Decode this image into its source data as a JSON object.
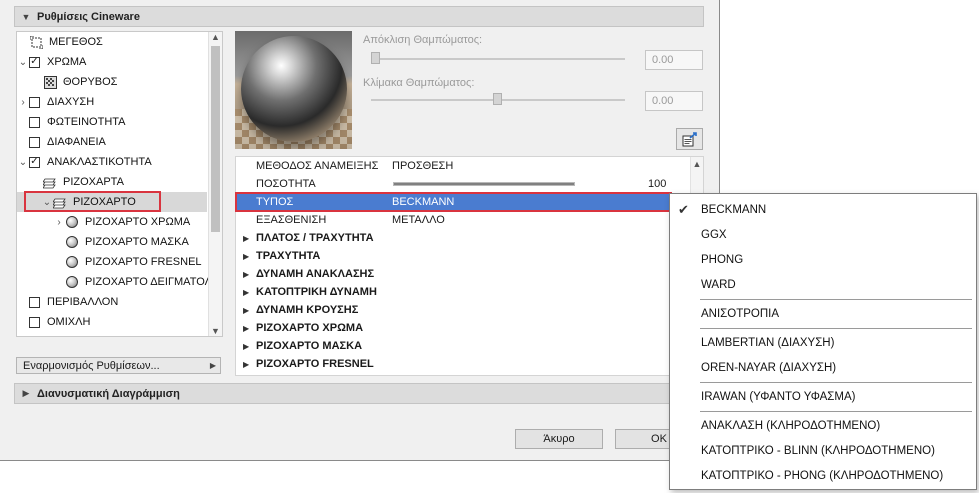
{
  "dialog": {
    "section_settings": "Ρυθμίσεις Cineware",
    "section_vector": "Διανυσματική Διαγράμμιση",
    "preset_label": "Εναρμονισμός Ρυθμίσεων...",
    "cancel_label": "Άκυρο",
    "ok_label": "OK"
  },
  "tree": {
    "items": [
      {
        "label": "ΜΕΓΕΘΟΣ"
      },
      {
        "label": "ΧΡΩΜΑ",
        "checked": true
      },
      {
        "label": "ΘΟΡΥΒΟΣ"
      },
      {
        "label": "ΔΙΑΧΥΣΗ",
        "checked": false
      },
      {
        "label": "ΦΩΤΕΙΝΟΤΗΤΑ",
        "checked": false
      },
      {
        "label": "ΔΙΑΦΑΝΕΙΑ",
        "checked": false
      },
      {
        "label": "ΑΝΑΚΛΑΣΤΙΚΟΤΗΤΑ",
        "checked": true
      },
      {
        "label": "ΡΙΖΟΧΑΡΤΑ"
      },
      {
        "label": "ΡΙΖΟΧΑΡΤΟ"
      },
      {
        "label": "ΡΙΖΟΧΑΡΤΟ ΧΡΩΜΑ"
      },
      {
        "label": "ΡΙΖΟΧΑΡΤΟ ΜΑΣΚΑ"
      },
      {
        "label": "ΡΙΖΟΧΑΡΤΟ FRESNEL"
      },
      {
        "label": "ΡΙΖΟΧΑΡΤΟ ΔΕΙΓΜΑΤΟΛ"
      },
      {
        "label": "ΠΕΡΙΒΑΛΛΟΝ",
        "checked": false
      },
      {
        "label": "ΟΜΙΧΛΗ",
        "checked": false
      }
    ]
  },
  "blur": {
    "offset_label": "Απόκλιση Θαμπώματος:",
    "offset_value": "0.00",
    "scale_label": "Κλίμακα Θαμπώματος:",
    "scale_value": "0.00"
  },
  "props": {
    "rows": [
      {
        "key": "ΜΕΘΟΔΟΣ ΑΝΑΜΕΙΞΗΣ",
        "value": "ΠΡΟΣΘΕΣΗ"
      },
      {
        "key": "ΠΟΣΟΤΗΤΑ",
        "value": "100",
        "level": 1.0
      },
      {
        "key": "ΤΥΠΟΣ",
        "value": "BECKMANN"
      },
      {
        "key": "ΕΞΑΣΘΕΝΙΣΗ",
        "value": "ΜΕΤΑΛΛΟ"
      }
    ],
    "groups": [
      "ΠΛΑΤΟΣ / ΤΡΑΧΥΤΗΤΑ",
      "ΤΡΑΧΥΤΗΤΑ",
      "ΔΥΝΑΜΗ ΑΝΑΚΛΑΣΗΣ",
      "ΚΑΤΟΠΤΡΙΚΗ ΔΥΝΑΜΗ",
      "ΔΥΝΑΜΗ ΚΡΟΥΣΗΣ",
      "ΡΙΖΟΧΑΡΤΟ ΧΡΩΜΑ",
      "ΡΙΖΟΧΑΡΤΟ ΜΑΣΚΑ",
      "ΡΙΖΟΧΑΡΤΟ FRESNEL"
    ]
  },
  "menu": {
    "check_mark": "✔",
    "items": [
      "BECKMANN",
      "GGX",
      "PHONG",
      "WARD",
      "ΑΝΙΣΟΤΡΟΠΙΑ",
      "LAMBERTIAN (ΔΙΑΧΥΣΗ)",
      "OREN-NAYAR (ΔΙΑΧΥΣΗ)",
      "IRAWAN (ΥΦΑΝΤΟ ΥΦΑΣΜΑ)",
      "ΑΝΑΚΛΑΣΗ (ΚΛΗΡΟΔΟΤΗΜΕΝΟ)",
      "ΚΑΤΟΠΤΡΙΚΟ - BLINN (ΚΛΗΡΟΔΟΤΗΜΕΝΟ)",
      "ΚΑΤΟΠΤΡΙΚΟ - PHONG (ΚΛΗΡΟΔΟΤΗΜΕΝΟ)"
    ],
    "selected": "BECKMANN"
  },
  "colors": {
    "selection": "#4a7cd0",
    "highlight_box": "#d9343f"
  }
}
